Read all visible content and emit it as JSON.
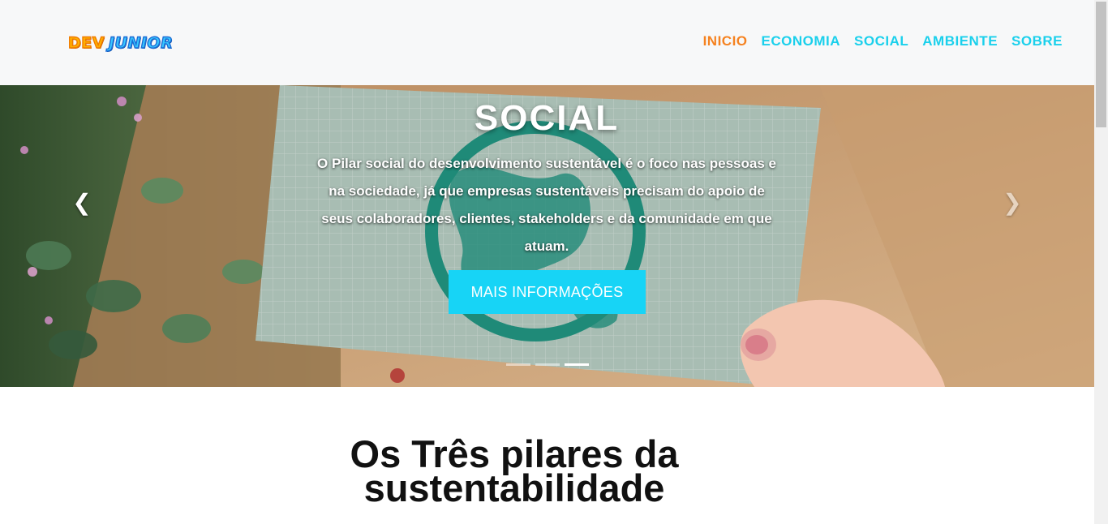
{
  "brand": {
    "part1": "DEV",
    "part2": "JUNIOR"
  },
  "nav": {
    "items": [
      {
        "label": "INICIO",
        "active": true
      },
      {
        "label": "ECONOMIA",
        "active": false
      },
      {
        "label": "SOCIAL",
        "active": false
      },
      {
        "label": "AMBIENTE",
        "active": false
      },
      {
        "label": "SOBRE",
        "active": false
      }
    ]
  },
  "carousel": {
    "title": "SOCIAL",
    "text": "O Pilar social do desenvolvimento sustentável é o foco nas pessoas e na sociedade, já que empresas sustentáveis precisam do apoio de seus colaboradores, clientes, stakeholders e da comunidade em que atuam.",
    "button_label": "MAIS INFORMAÇÕES",
    "prev_icon": "chevron-left-icon",
    "next_icon": "chevron-right-icon",
    "slides_count": 3,
    "active_slide": 3
  },
  "section": {
    "title": "Os Três pilares da sustentabilidade"
  },
  "colors": {
    "accent_cyan": "#17d4f6",
    "nav_active": "#f58220",
    "navbar_bg": "#f7f8f9"
  }
}
